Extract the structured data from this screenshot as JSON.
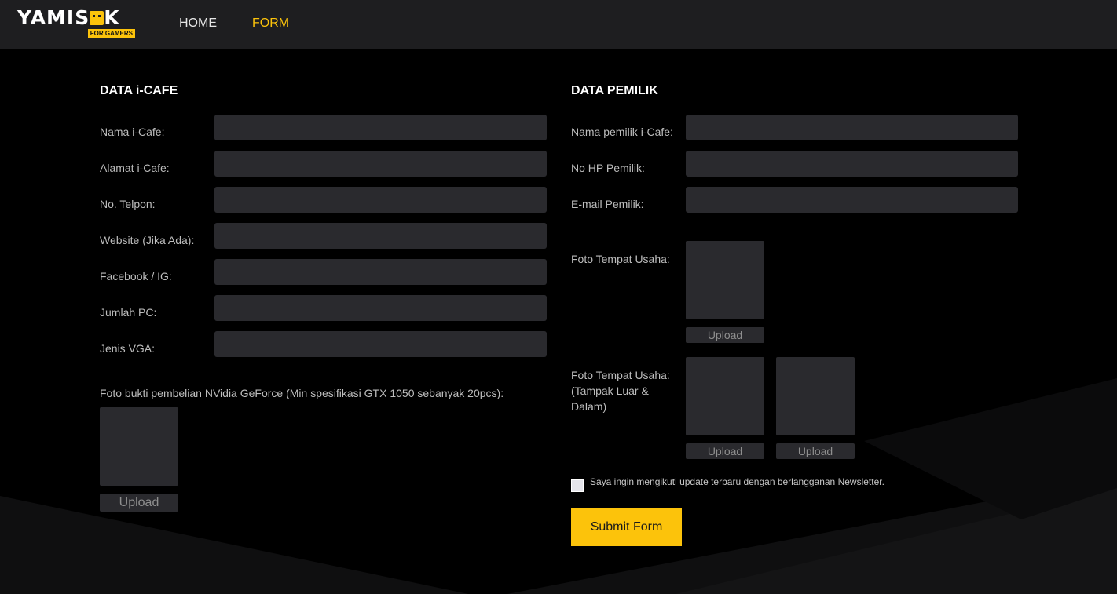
{
  "header": {
    "logo_text": "YAMIS",
    "logo_text_end": "K",
    "logo_tagline": "FOR GAMERS",
    "nav": [
      {
        "label": "HOME"
      },
      {
        "label": "FORM"
      }
    ]
  },
  "icafe": {
    "title": "DATA i-CAFE",
    "fields": [
      {
        "label": "Nama i-Cafe:",
        "value": ""
      },
      {
        "label": "Alamat i-Cafe:",
        "value": ""
      },
      {
        "label": "No. Telpon:",
        "value": ""
      },
      {
        "label": "Website (Jika Ada):",
        "value": ""
      },
      {
        "label": "Facebook / IG:",
        "value": ""
      },
      {
        "label": "Jumlah PC:",
        "value": ""
      },
      {
        "label": "Jenis VGA:",
        "value": ""
      }
    ],
    "proof_label": "Foto bukti pembelian NVidia GeForce (Min spesifikasi GTX 1050 sebanyak 20pcs):",
    "upload_label": "Upload"
  },
  "owner": {
    "title": "DATA PEMILIK",
    "fields": [
      {
        "label": "Nama pemilik i-Cafe:",
        "value": ""
      },
      {
        "label": "No HP Pemilik:",
        "value": ""
      },
      {
        "label": "E-mail Pemilik:",
        "value": ""
      }
    ],
    "photo1_label": "Foto Tempat Usaha:",
    "photo2_label_line1": "Foto Tempat Usaha:",
    "photo2_label_line2": "(Tampak Luar &",
    "photo2_label_line3": "Dalam)",
    "upload_label": "Upload"
  },
  "newsletter": {
    "label": "Saya ingin mengikuti update terbaru dengan berlangganan Newsletter.",
    "checked": false
  },
  "submit_label": "Submit Form",
  "colors": {
    "accent": "#fcc30b",
    "header_bg": "#1e1e20",
    "input_bg": "#2a2a2e",
    "page_bg": "#000000"
  }
}
